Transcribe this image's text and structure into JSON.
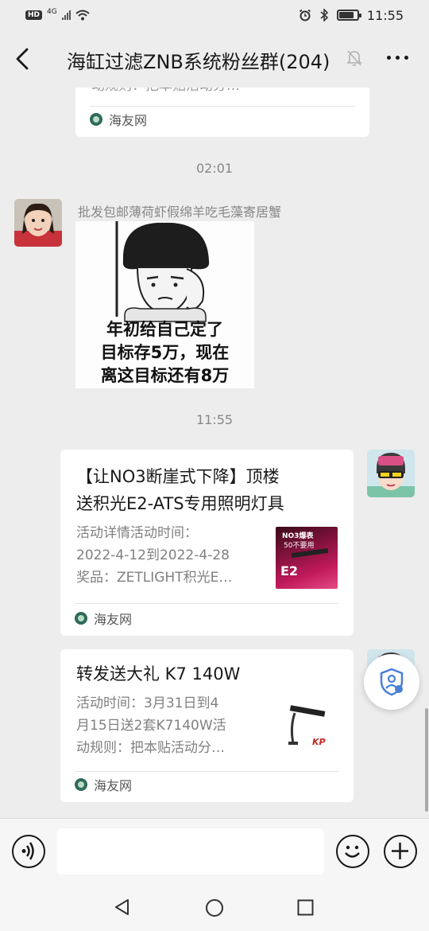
{
  "status_bar": {
    "hd_label": "HD",
    "network": "4G",
    "time": "11:55"
  },
  "header": {
    "title": "海缸过滤ZNB系统粉丝群(204)",
    "back_icon": "chevron-left-icon",
    "mute_icon": "bell-off-icon",
    "more_icon": "more-dots-icon"
  },
  "messages": {
    "prev_card": {
      "desc_tail": "动规则：把本贴活动分…",
      "source": "海友网"
    },
    "time_1": "02:01",
    "sticker_msg": {
      "sender": "批发包邮薄荷虾假绵羊吃毛藻寄居蟹",
      "sticker_text": [
        "年初给自己定了",
        "目标存5万，现在",
        "离这目标还有8万"
      ]
    },
    "time_2": "11:55",
    "card_1": {
      "title_line1": "【让NO3断崖式下降】顶楼",
      "title_line2": "送积光E2-ATS专用照明灯具",
      "desc_line1": "活动详情活动时间：",
      "desc_line2": "2022-4-12到2022-4-28",
      "desc_line3": "奖品：ZETLIGHT积光E…",
      "thumb_text_1": "NO3爆表",
      "thumb_text_2": "50不要用",
      "thumb_text_3": "E2",
      "source": "海友网"
    },
    "card_2": {
      "title": "转发送大礼 K7 140W",
      "desc_line1": "活动时间：3月31日到4",
      "desc_line2": "月15日送2套K7140W活",
      "desc_line3": "动规则：把本贴活动分…",
      "thumb_text": "KP",
      "source": "海友网"
    }
  },
  "floating_button": {
    "icon": "shield-person-icon"
  },
  "input_bar": {
    "voice_icon": "voice-icon",
    "emoji_icon": "emoji-icon",
    "plus_icon": "plus-icon",
    "placeholder": ""
  },
  "nav_bar": {
    "back_icon": "triangle-back-icon",
    "home_icon": "circle-home-icon",
    "recents_icon": "square-recents-icon"
  },
  "colors": {
    "background": "#ededed",
    "bubble": "#ffffff",
    "timestamp": "#888888",
    "source_text": "#555555"
  }
}
